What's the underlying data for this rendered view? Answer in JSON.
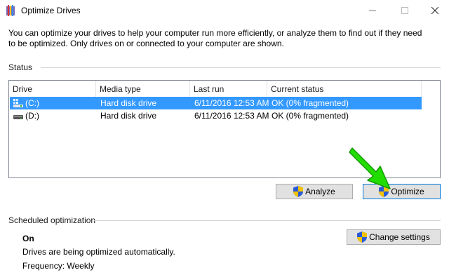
{
  "window": {
    "title": "Optimize Drives"
  },
  "intro_text": "You can optimize your drives to help your computer run more efficiently, or analyze them to find out if they need to be optimized. Only drives on or connected to your computer are shown.",
  "status": {
    "label": "Status",
    "columns": [
      "Drive",
      "Media type",
      "Last run",
      "Current status"
    ],
    "rows": [
      {
        "drive": "(C:)",
        "media": "Hard disk drive",
        "last_run": "6/11/2016 12:53 AM",
        "status": "OK (0% fragmented)",
        "selected": true,
        "icon": "system-drive-icon"
      },
      {
        "drive": "(D:)",
        "media": "Hard disk drive",
        "last_run": "6/11/2016 12:53 AM",
        "status": "OK (0% fragmented)",
        "selected": false,
        "icon": "hard-drive-icon"
      }
    ]
  },
  "buttons": {
    "analyze": "Analyze",
    "optimize": "Optimize",
    "change_settings": "Change settings"
  },
  "scheduled": {
    "label": "Scheduled optimization",
    "state": "On",
    "description": "Drives are being optimized automatically.",
    "frequency": "Frequency: Weekly"
  },
  "colors": {
    "selection": "#3399ff",
    "annotation_arrow": "#22dd00",
    "shield_blue": "#2a5bd7",
    "shield_yellow": "#f2c200"
  }
}
